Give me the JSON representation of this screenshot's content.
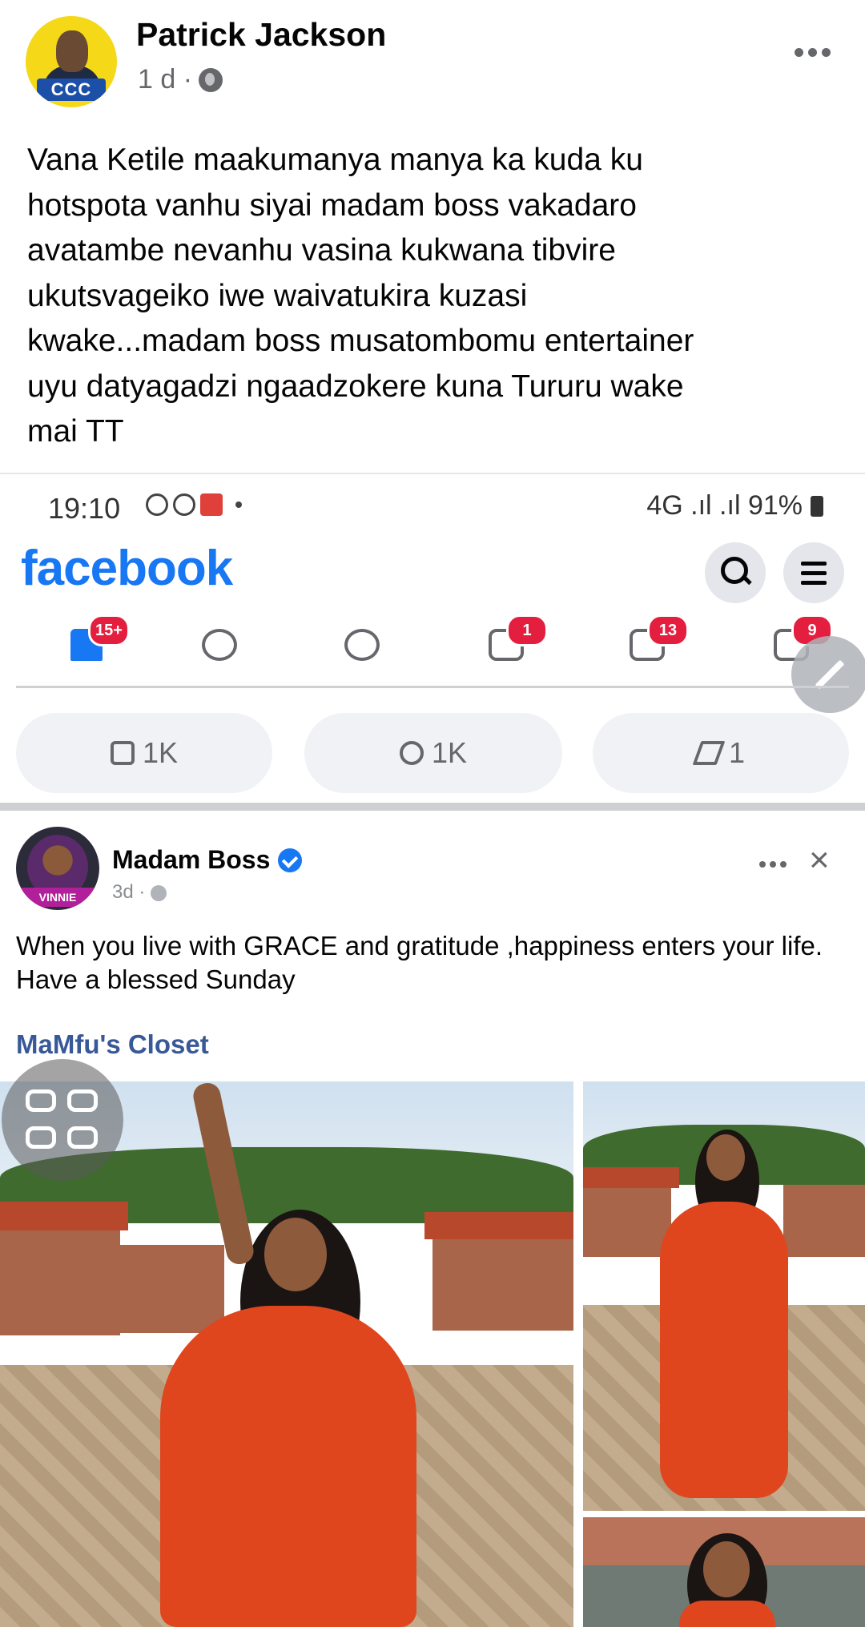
{
  "outer_post": {
    "author": "Patrick Jackson",
    "time": "1 d ·",
    "avatar_badge": "CCC",
    "text": "Vana Ketile maakumanya manya ka kuda ku\nhotspota vanhu siyai madam boss vakadaro\navatambe nevanhu vasina kukwana tibvire\nukutsvageiko iwe waivatukira kuzasi\nkwake...madam boss musatombomu entertainer\nuyu datyagadzi ngaadzokere kuna Tururu wake\nmai TT"
  },
  "screenshot": {
    "status_bar": {
      "time": "19:10",
      "right": "4G .ıl .ıl 91%"
    },
    "app_logo": "facebook",
    "nav_badges": {
      "home": "15+",
      "notifications": "1",
      "videos": "13",
      "marketplace": "9"
    },
    "actions": {
      "like": "1K",
      "comment": "1K",
      "share": "1"
    },
    "inner_post": {
      "author": "Madam Boss",
      "meta": "3d ·",
      "avatar_band": "VINNIE",
      "text_line1": "When you live with GRACE and gratitude ,happiness enters your life.",
      "text_line2": "Have a blessed Sunday",
      "link": "MaMfu's Closet"
    }
  },
  "colors": {
    "facebook_blue": "#1877f2",
    "badge_red": "#e41e3f",
    "dress_orange": "#e0461e",
    "ccc_yellow": "#f5d817"
  }
}
